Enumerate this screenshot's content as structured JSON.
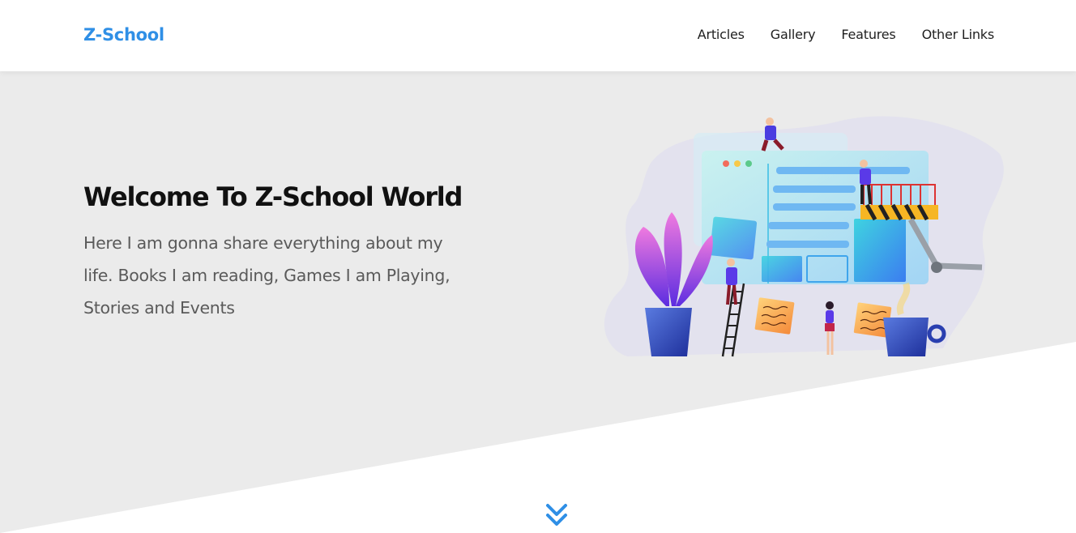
{
  "brand": {
    "name": "Z-School"
  },
  "nav": {
    "items": [
      {
        "label": "Articles"
      },
      {
        "label": "Gallery"
      },
      {
        "label": "Features"
      },
      {
        "label": "Other Links"
      }
    ]
  },
  "hero": {
    "title": "Welcome To Z-School World",
    "text": "Here I am gonna share everything about my life. Books I am reading, Games I am Playing, Stories and Events"
  },
  "icons": {
    "scroll": "double-chevron-down-icon",
    "illustration": "website-building-team-illustration"
  },
  "colors": {
    "brand": "#2f8fe6",
    "hero_bg": "#ebebeb",
    "accent": "#2f8fe6"
  }
}
